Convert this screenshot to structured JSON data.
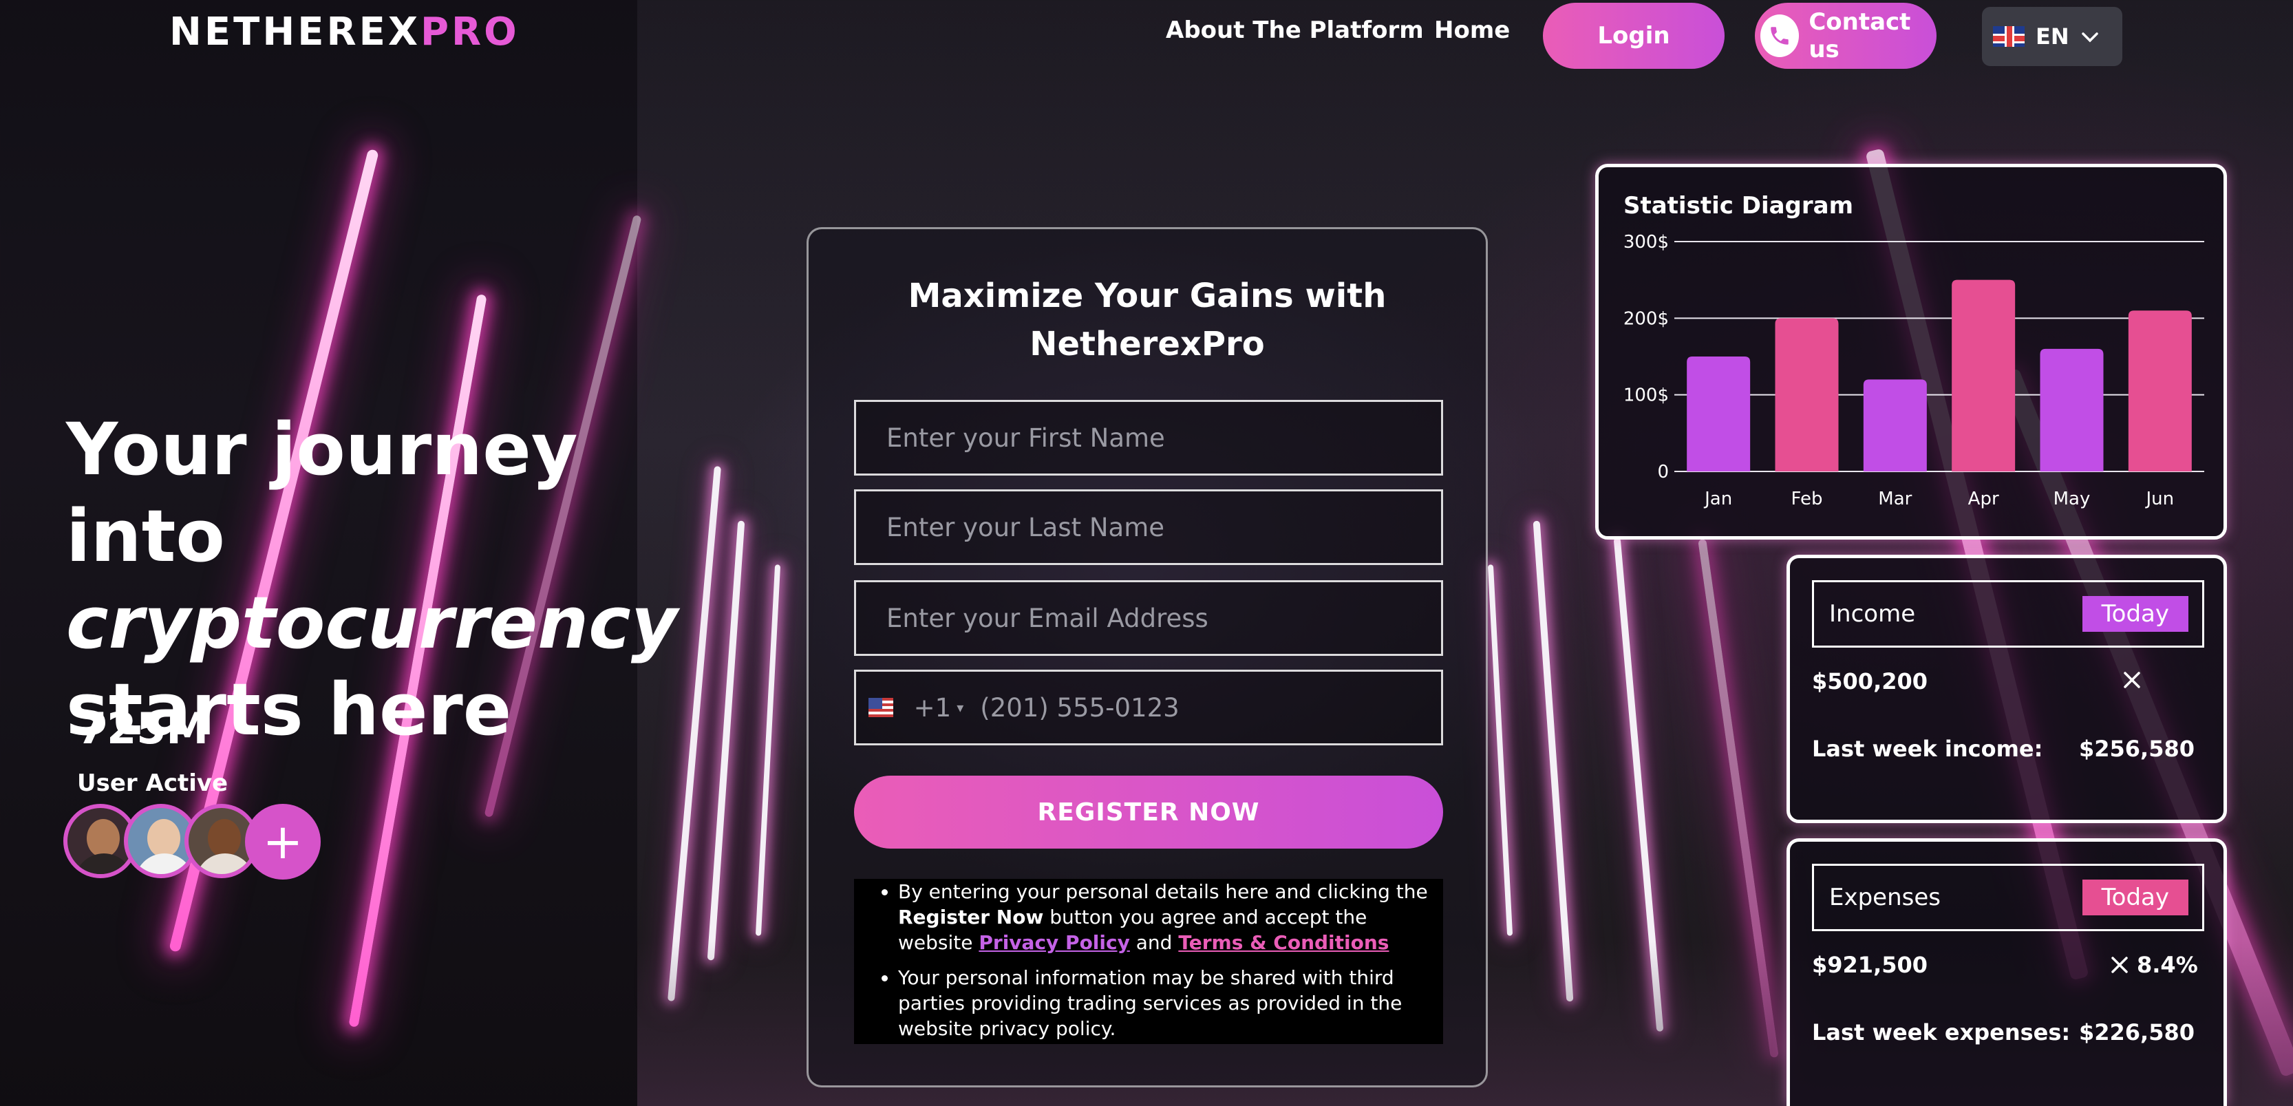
{
  "header": {
    "logo_part1": "NETHEREX",
    "logo_part2": "PRO",
    "nav": {
      "about": "About The Platform",
      "home": "Home"
    },
    "login_label": "Login",
    "contact_label": "Contact us",
    "language": "EN"
  },
  "hero": {
    "line1": "Your journey into",
    "line2": "cryptocurrency",
    "line3": "starts here",
    "users_count": "725M",
    "users_label": "User Active",
    "plus_glyph": "+"
  },
  "form": {
    "title": "Maximize Your Gains with NetherexPro",
    "first_name_placeholder": "Enter your First Name",
    "last_name_placeholder": "Enter your Last Name",
    "email_placeholder": "Enter your Email Address",
    "dial_code": "+1",
    "phone_placeholder": "(201) 555-0123",
    "register_label": "REGISTER NOW",
    "disclaimer1_pre": "By entering your personal details here and clicking the ",
    "disclaimer1_bold": "Register Now",
    "disclaimer1_mid": " button you agree and accept the website ",
    "privacy_link": "Privacy Policy",
    "and_text": " and ",
    "terms_link": "Terms & Conditions",
    "disclaimer2": "Your personal information may be shared with third parties providing trading services as provided in the website privacy policy."
  },
  "chart_data": {
    "type": "bar",
    "title": "Statistic Diagram",
    "categories": [
      "Jan",
      "Feb",
      "Mar",
      "Apr",
      "May",
      "Jun"
    ],
    "values": [
      150,
      200,
      120,
      250,
      160,
      210
    ],
    "bar_colors": [
      "#c14ee6",
      "#e64f92",
      "#c14ee6",
      "#e64f92",
      "#c14ee6",
      "#e64f92"
    ],
    "ylim": [
      0,
      300
    ],
    "yticks": [
      "0",
      "100$",
      "200$",
      "300$"
    ],
    "grid": true
  },
  "income": {
    "label": "Income",
    "badge": "Today",
    "badge_color": "#c14ee6",
    "amount": "$500,200",
    "last_week_label": "Last week income:",
    "last_week_value": "$256,580"
  },
  "expenses": {
    "label": "Expenses",
    "badge": "Today",
    "badge_color": "#e64f92",
    "amount": "$921,500",
    "change": "8.4%",
    "last_week_label": "Last week expenses:",
    "last_week_value": "$226,580"
  }
}
